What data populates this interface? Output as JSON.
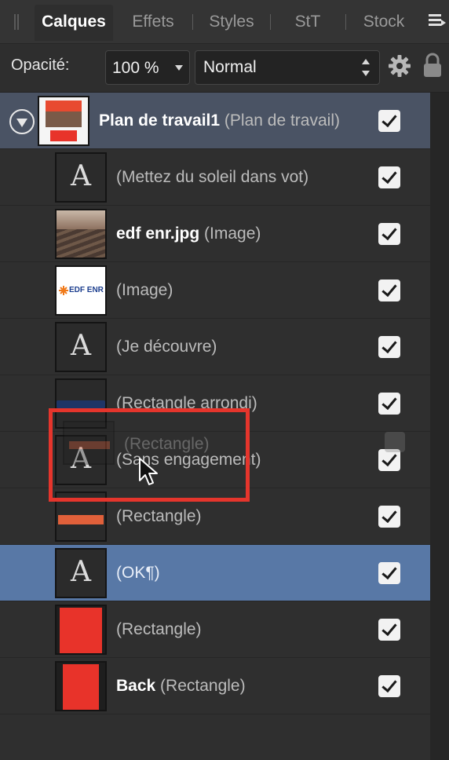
{
  "tabs": [
    "Calques",
    "Effets",
    "Styles",
    "StT",
    "Stock"
  ],
  "toolbar": {
    "opacity_label": "Opacité:",
    "opacity_value": "100 %",
    "blend_mode": "Normal"
  },
  "artboard": {
    "name": "Plan de travail1",
    "type": "(Plan de travail)"
  },
  "layers": [
    {
      "name": "",
      "type": "(Mettez du soleil dans vot)",
      "thumb": "text"
    },
    {
      "name": "edf enr.jpg",
      "type": "(Image)",
      "thumb": "photo"
    },
    {
      "name": "",
      "type": "(Image)",
      "thumb": "logo",
      "logo_text": "EDF ENR"
    },
    {
      "name": "",
      "type": "(Je découvre)",
      "thumb": "text"
    },
    {
      "name": "",
      "type": "(Rectangle arrondi)",
      "thumb": "navy"
    },
    {
      "name": "",
      "type": "(Sans engagement)",
      "thumb": "text"
    },
    {
      "name": "",
      "type": "(Rectangle)",
      "thumb": "orange-bar"
    },
    {
      "name": "",
      "type": "(OK¶)",
      "thumb": "text"
    },
    {
      "name": "",
      "type": "(Rectangle)",
      "thumb": "red"
    },
    {
      "name": "Back",
      "type": "(Rectangle)",
      "thumb": "red"
    }
  ],
  "drag_ghost": {
    "label": "(Rectangle)"
  },
  "text_thumb_glyph": "A",
  "colors": {
    "selected_row": "#5878a6",
    "artboard_row": "#4a5364",
    "highlight": "#e5352c",
    "red_shape": "#e8332a",
    "orange_bar": "#e0603a"
  }
}
